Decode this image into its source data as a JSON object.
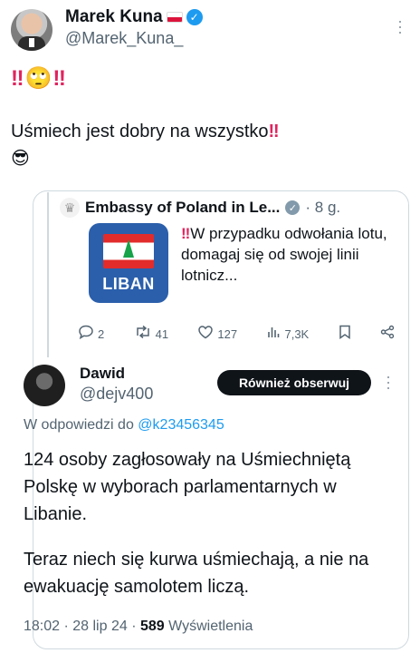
{
  "post": {
    "display_name": "Marek Kuna",
    "handle": "@Marek_Kuna_",
    "emoji_line": "‼🙄‼",
    "text": "Uśmiech jest dobry na wszystko",
    "text_emphasis": "‼",
    "emoji_trailer": "😎"
  },
  "quoted": {
    "account_name": "Embassy of Poland in Le...",
    "time": "· 8 g.",
    "image_label": "LIBAN",
    "text_emphasis": "‼",
    "text": "W przypadku odwołania lotu, domagaj się od swojej linii lotnicz..."
  },
  "actions": {
    "replies": "2",
    "reposts": "41",
    "likes": "127",
    "views": "7,3K"
  },
  "reply": {
    "display_name": "Dawid",
    "handle": "@dejv400",
    "follow_label": "Również obserwuj",
    "reply_to_prefix": "W odpowiedzi do",
    "reply_to_handle": "@k23456345",
    "paragraph1": "124 osoby zagłosowały na Uśmiechniętą Polskę w wyborach parlamentarnych w Libanie.",
    "paragraph2": "Teraz niech się kurwa uśmiechają, a nie na ewakuację samolotem liczą.",
    "timestamp": "18:02 · 28 lip 24 ·",
    "view_count": "589",
    "views_label": "Wyświetlenia"
  },
  "icons": {
    "verified": "blue-check",
    "more": "three-dots-vertical",
    "reply": "speech-bubble",
    "repost": "retweet-arrows",
    "like": "heart",
    "views": "bar-chart",
    "bookmark": "bookmark",
    "share": "share"
  }
}
